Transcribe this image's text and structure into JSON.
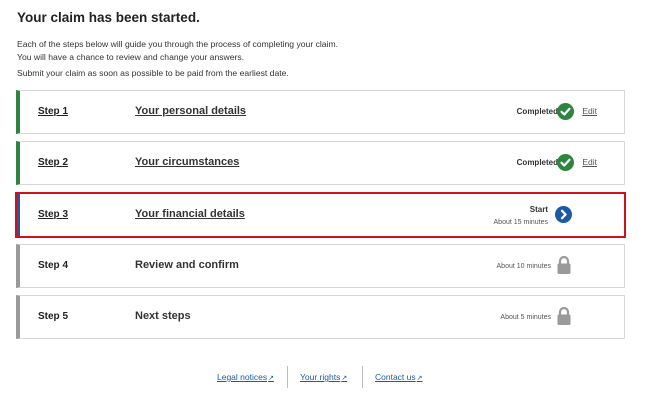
{
  "page": {
    "title": "Your claim has been started.",
    "intro": [
      "Each of the steps below will guide you through the process of completing your claim.",
      "You will have a chance to review and change your answers.",
      "Submit your claim as soon as possible to be paid from the earliest date."
    ]
  },
  "steps": [
    {
      "number": "Step 1",
      "title": "Your personal details",
      "status": "Completed",
      "action": "Edit",
      "state": "completed"
    },
    {
      "number": "Step 2",
      "title": "Your circumstances",
      "status": "Completed",
      "action": "Edit",
      "state": "completed"
    },
    {
      "number": "Step 3",
      "title": "Your financial details",
      "status": "Start",
      "time": "About 15 minutes",
      "state": "active"
    },
    {
      "number": "Step 4",
      "title": "Review and confirm",
      "time": "About 10 minutes",
      "state": "locked"
    },
    {
      "number": "Step 5",
      "title": "Next steps",
      "time": "About 5 minutes",
      "state": "locked"
    }
  ],
  "footer": {
    "links": [
      "Legal notices",
      "Your rights",
      "Contact us"
    ]
  },
  "colors": {
    "completed": "#2e8540",
    "active": "#1a5aa6",
    "locked": "#9a9a9a",
    "highlight": "#d0101c"
  },
  "icons": {
    "completed": "check-circle-icon",
    "active": "chevron-right-circle-icon",
    "locked": "padlock-icon",
    "external": "external-link-icon"
  }
}
